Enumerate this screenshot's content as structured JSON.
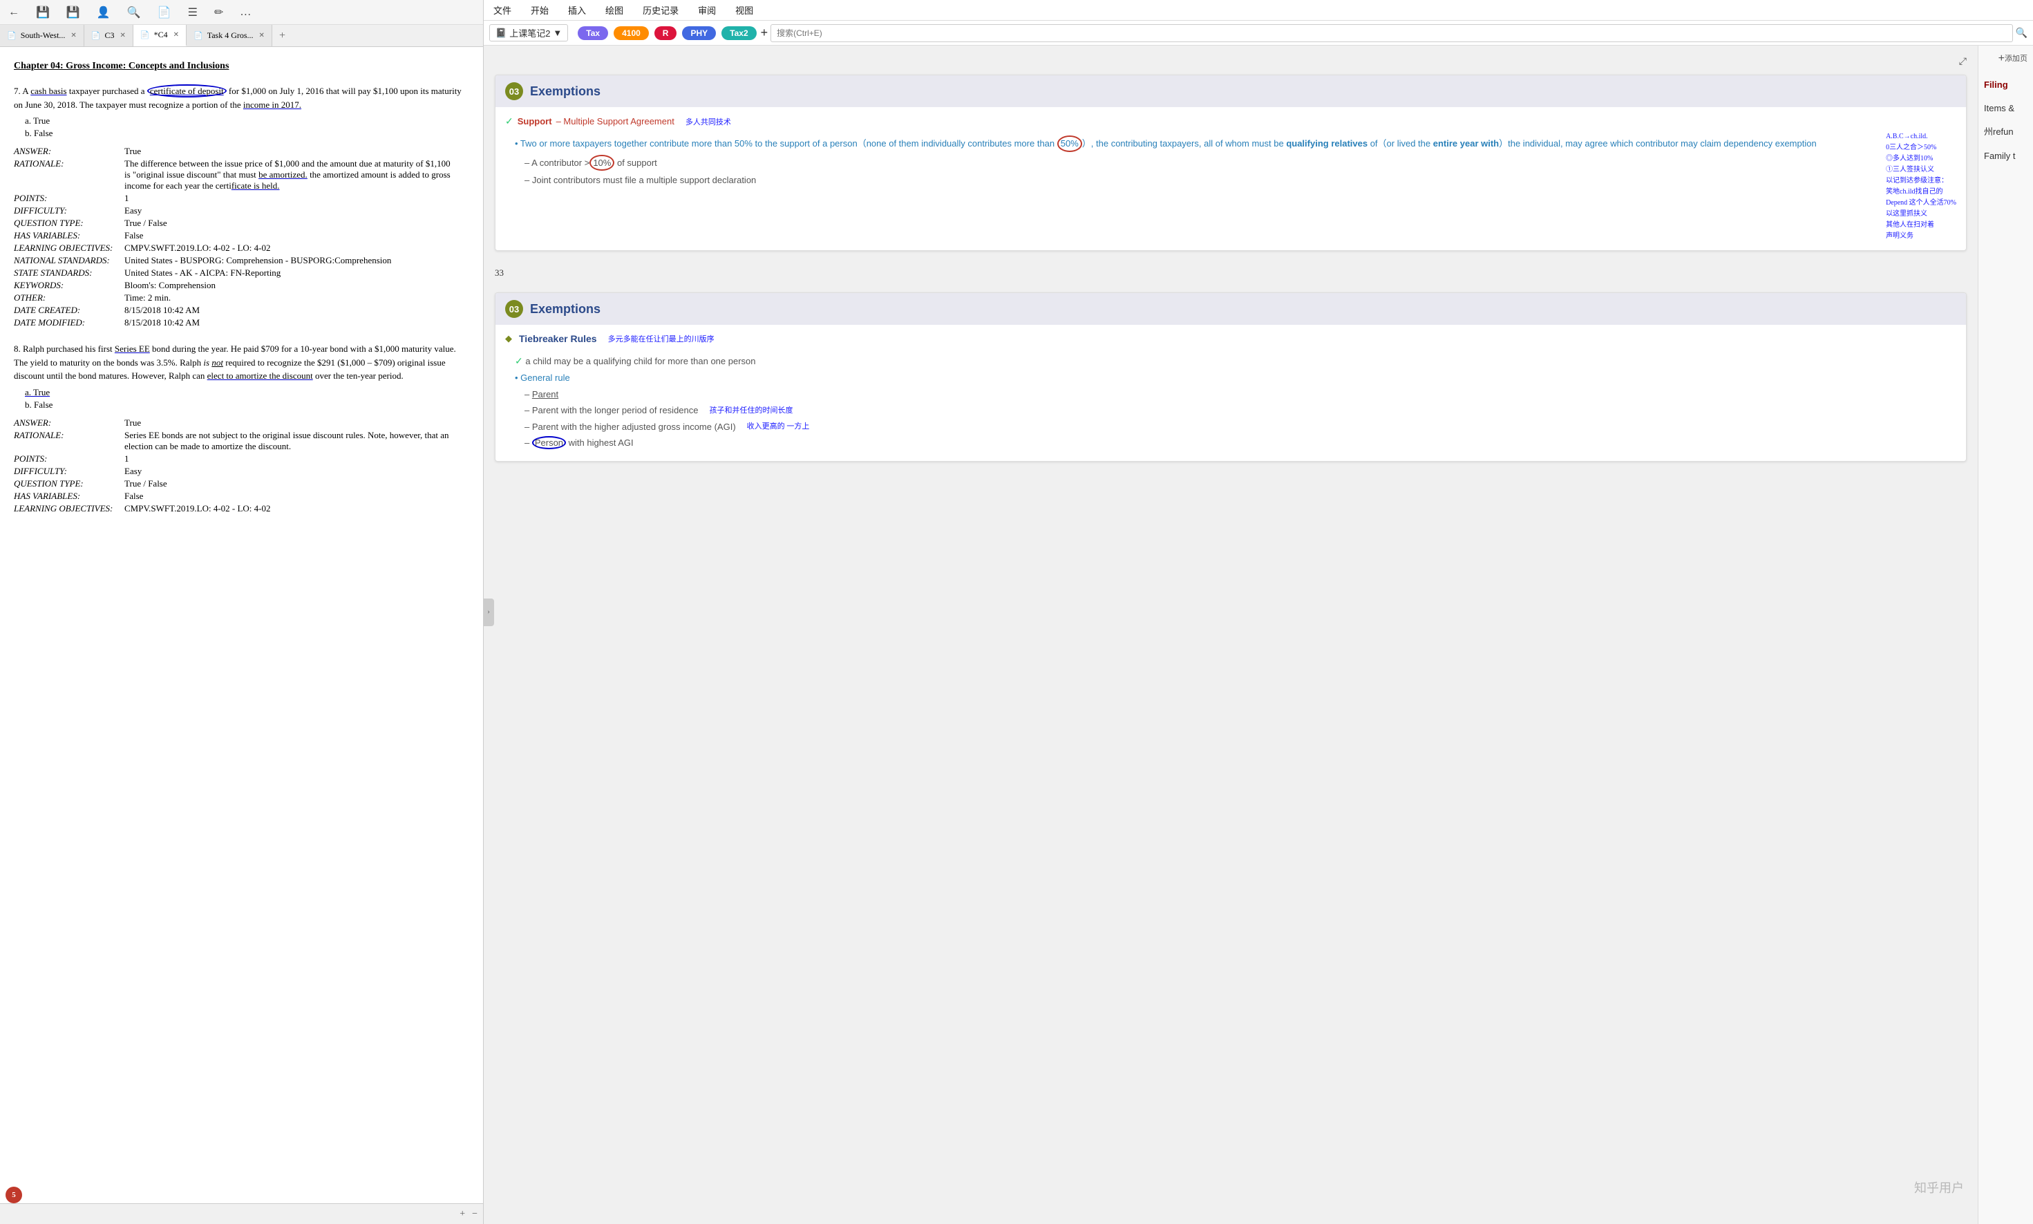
{
  "left_panel": {
    "toolbar": {
      "icons": [
        "←",
        "💾",
        "💾",
        "👤",
        "🔍",
        "📄",
        "☰",
        "✏",
        "…"
      ]
    },
    "tabs": [
      {
        "id": "tab1",
        "label": "South-West...",
        "active": false,
        "icon": "📄"
      },
      {
        "id": "tab2",
        "label": "C3",
        "active": false,
        "icon": "📄"
      },
      {
        "id": "tab3",
        "label": "*C4",
        "active": true,
        "icon": "📄"
      },
      {
        "id": "tab4",
        "label": "Task 4 Gros...",
        "active": false,
        "icon": "📄"
      }
    ],
    "chapter_title": "Chapter 04: Gross Income: Concepts and Inclusions",
    "questions": [
      {
        "number": "7.",
        "text": "A cash basis taxpayer purchased a certificate of deposit for $1,000 on July 1, 2016 that will pay $1,100 upon its maturity on June 30, 2018. The taxpayer must recognize a portion of the income in 2017.",
        "options": [
          "a.  True",
          "b.  False"
        ],
        "answer_rows": [
          {
            "label": "ANSWER:",
            "value": "True"
          },
          {
            "label": "RATIONALE:",
            "value": "The difference between the issue price of $1,000 and the amount due at maturity of $1,100 is \"original issue discount\" that must be amortized. the amortized amount is added to gross income for each year the certificate is held."
          },
          {
            "label": "POINTS:",
            "value": "1"
          },
          {
            "label": "DIFFICULTY:",
            "value": "Easy"
          },
          {
            "label": "QUESTION TYPE:",
            "value": "True / False"
          },
          {
            "label": "HAS VARIABLES:",
            "value": "False"
          },
          {
            "label": "LEARNING OBJECTIVES:",
            "value": "CMPV.SWFT.2019.LO: 4-02 - LO: 4-02"
          },
          {
            "label": "NATIONAL STANDARDS:",
            "value": "United States - BUSPORG: Comprehension - BUSPORG:Comprehension"
          },
          {
            "label": "STATE STANDARDS:",
            "value": "United States - AK - AICPA: FN-Reporting"
          },
          {
            "label": "KEYWORDS:",
            "value": "Bloom's: Comprehension"
          },
          {
            "label": "OTHER:",
            "value": "Time: 2 min."
          },
          {
            "label": "DATE CREATED:",
            "value": "8/15/2018 10:42 AM"
          },
          {
            "label": "DATE MODIFIED:",
            "value": "8/15/2018 10:42 AM"
          }
        ]
      },
      {
        "number": "8.",
        "text": "Ralph purchased his first Series EE bond during the year. He paid $709 for a 10-year bond with a $1,000 maturity value. The yield to maturity on the bonds was 3.5%. Ralph is not required to recognize the $291 ($1,000 – $709) original issue discount until the bond matures. However, Ralph can elect to amortize the discount over the ten-year period.",
        "options": [
          "a.  True",
          "b.  False"
        ],
        "answer_rows": [
          {
            "label": "ANSWER:",
            "value": "True"
          },
          {
            "label": "RATIONALE:",
            "value": "Series EE bonds are not subject to the original issue discount rules. Note, however, that an election can be made to amortize the discount."
          },
          {
            "label": "POINTS:",
            "value": "1"
          },
          {
            "label": "DIFFICULTY:",
            "value": "Easy"
          },
          {
            "label": "QUESTION TYPE:",
            "value": "True / False"
          },
          {
            "label": "HAS VARIABLES:",
            "value": "False"
          },
          {
            "label": "LEARNING OBJECTIVES:",
            "value": "CMPV.SWFT.2019.LO: 4-02 - LO: 4-02"
          }
        ]
      }
    ],
    "bottom": {
      "page_indicator": "5",
      "icons": [
        "+",
        "−"
      ]
    }
  },
  "right_panel": {
    "menubar": [
      "文件",
      "开始",
      "插入",
      "绘图",
      "历史记录",
      "审阅",
      "视图"
    ],
    "notebook_name": "上课笔记2",
    "tags": [
      "Tax",
      "4100",
      "R",
      "PHY",
      "Tax2"
    ],
    "search_placeholder": "搜索(Ctrl+E)",
    "sidebar": {
      "items": [
        "Filing",
        "Items &",
        "州refun",
        "Family t"
      ]
    },
    "expand_icon": "⤢",
    "add_button": "添加页",
    "cards": [
      {
        "id": "card1",
        "badge": "03",
        "title": "Exemptions",
        "page_num": "33",
        "support_label": "Support",
        "support_subtitle": "– Multiple Support Agreement",
        "handwrite1": "多人共同技术",
        "bullets": [
          {
            "text": "Two or more taxpayers together contribute more than 50% to the support of a person（none of them individually contributes more than",
            "highlight": "50%",
            "text2": "), the contributing taxpayers, all of whom must be qualifying relatives of（or lived the entire year with）the individual, may agree which contributor may claim dependency exemption"
          }
        ],
        "handwrite_right": "A.B.C→ch.ild.\n0三人之合＞50%\n◎多人达到10%\n①三人签扶认义\n以记到达参级注意：\n笑地ch.ild找自己\n的Depend 这个人全活70%\n以这里抓扶义\n其他人在扫对着\n声明义务",
        "dashes": [
          "A contributor > 10% of support",
          "Joint contributors must file a multiple support declaration"
        ]
      },
      {
        "id": "card2",
        "badge": "03",
        "title": "Exemptions",
        "tiebreaker_title": "Tiebreaker Rules",
        "handwrite_title": "多元多能在任让们最上的川版序",
        "qualifying_text": "a child may be a qualifying child for more than one person",
        "general_rule": "General rule",
        "dash_items": [
          "Parent",
          "Parent with the longer period of residence",
          "Parent with the higher adjusted gross income (AGI)",
          "Person with highest AGI"
        ],
        "handwrite_r1": "孩子和并任住的时间长度",
        "handwrite_r2": "收入更高的 一方上",
        "circle_item": "Person"
      }
    ]
  }
}
